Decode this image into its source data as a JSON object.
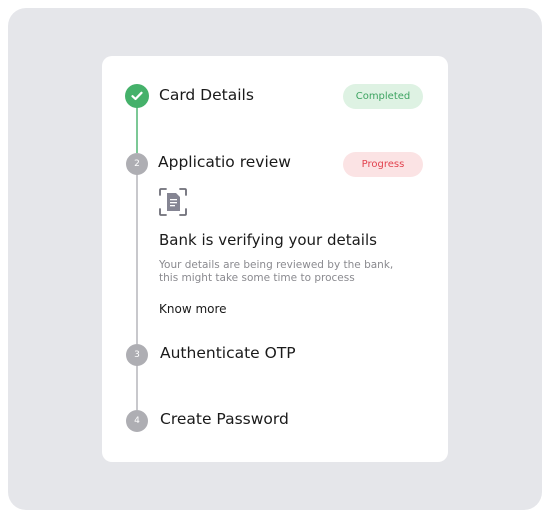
{
  "steps": [
    {
      "number": "1",
      "title": "Card Details",
      "status": "Completed",
      "state": "done"
    },
    {
      "number": "2",
      "title": "Applicatio review",
      "status": "Progress",
      "state": "active"
    },
    {
      "number": "3",
      "title": "Authenticate OTP",
      "state": "pending"
    },
    {
      "number": "4",
      "title": "Create Password",
      "state": "pending"
    }
  ],
  "active_detail": {
    "icon": "document-scan-icon",
    "title": "Bank is verifying your details",
    "description": "Your details are being reviewed by the bank, this might take some time to process",
    "link_label": "Know more"
  },
  "colors": {
    "completed_green": "#45b16a",
    "completed_badge_bg": "#def2e3",
    "progress_red": "#e2434f",
    "progress_badge_bg": "#fbe3e4",
    "pending_grey": "#aeaeb3",
    "backdrop": "#e5e6ea"
  }
}
